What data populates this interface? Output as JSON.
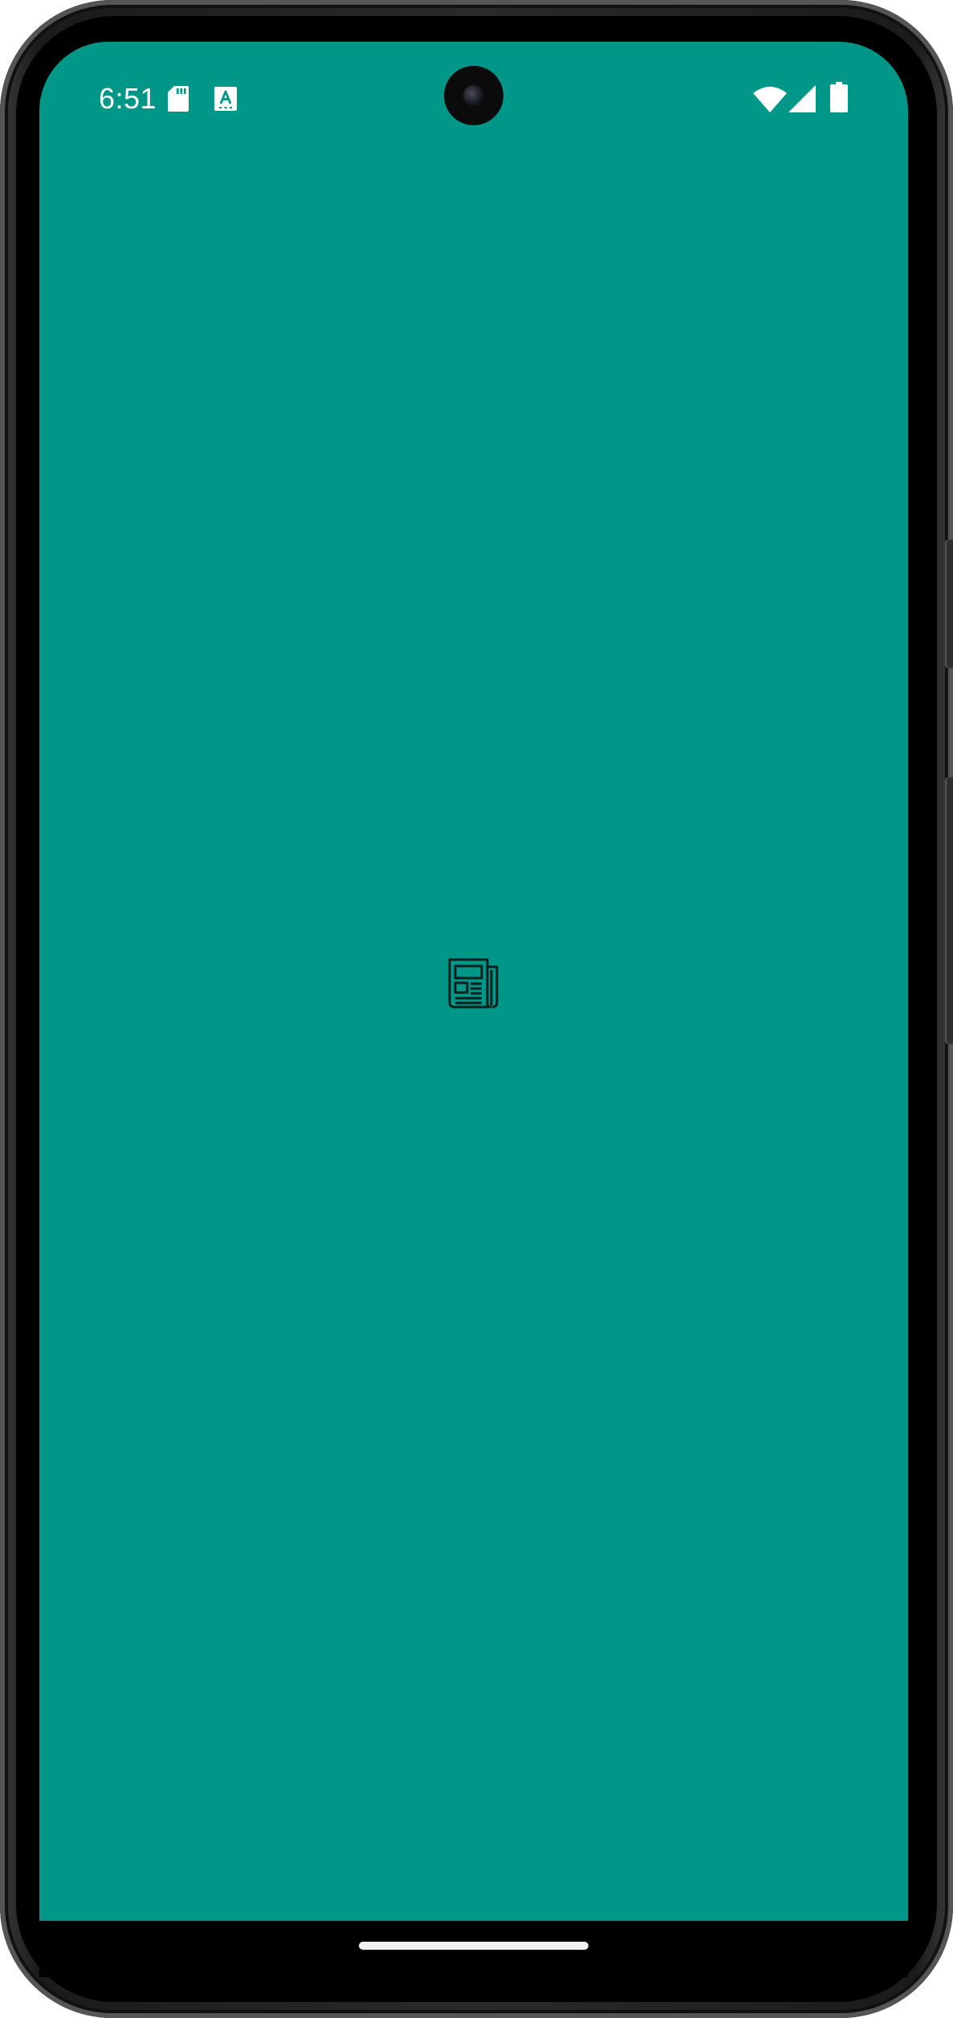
{
  "status_bar": {
    "time": "6:51",
    "notification_icons": [
      "sd-card-icon",
      "a-keyboard-icon"
    ],
    "system_icons": [
      "wifi-icon",
      "cell-signal-icon",
      "battery-icon"
    ],
    "text_color": "#ffffff"
  },
  "screen": {
    "background_color": "#009688",
    "center_icon": "newspaper-icon"
  },
  "navigation": {
    "gesture_handle": "home-gesture-handle"
  }
}
